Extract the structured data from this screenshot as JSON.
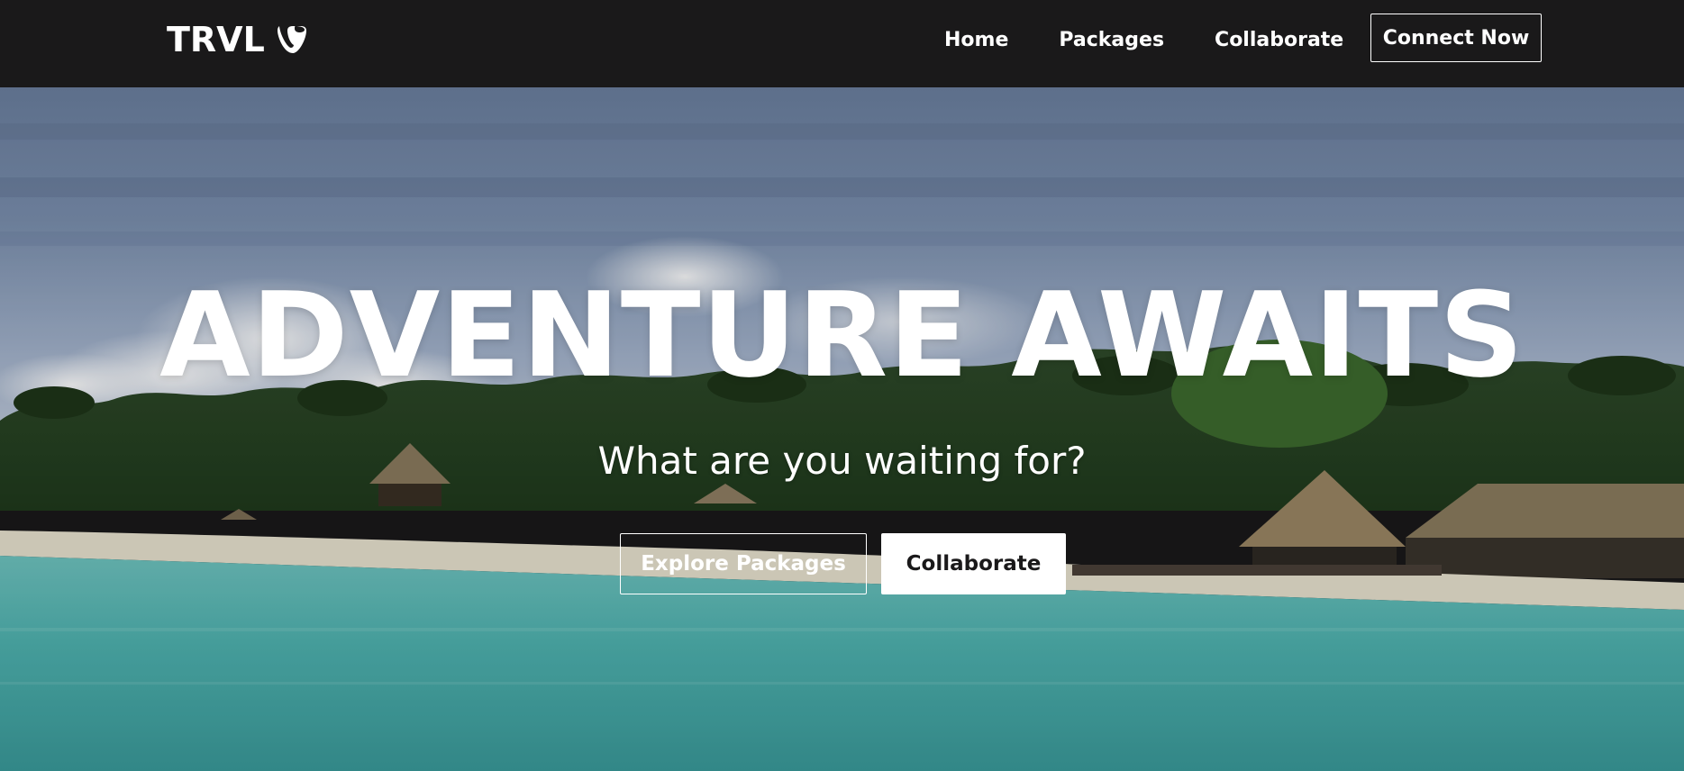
{
  "navbar": {
    "brand": "TRVL",
    "brand_icon": "typo3-logo-icon",
    "links": [
      {
        "label": "Home"
      },
      {
        "label": "Packages"
      },
      {
        "label": "Collaborate"
      }
    ],
    "cta_label": "Connect Now"
  },
  "hero": {
    "title": "ADVENTURE AWAITS",
    "subtitle": "What are you waiting for?",
    "primary_button": "Explore Packages",
    "secondary_button": "Collaborate",
    "background": "tropical-beach-resort-photo"
  },
  "colors": {
    "navbar_bg": "#1a191a",
    "text": "#ffffff",
    "button_solid_bg": "#ffffff",
    "button_solid_text": "#1a191a"
  }
}
